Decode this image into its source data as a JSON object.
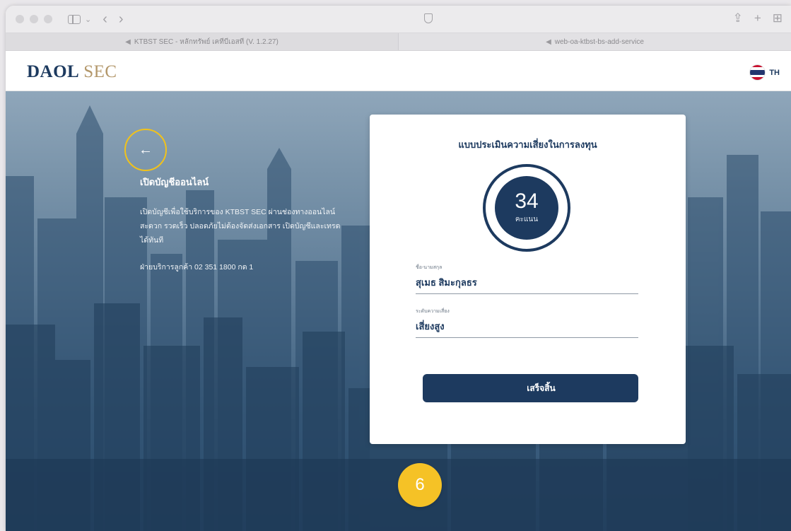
{
  "browser": {
    "tabs": [
      {
        "label": "KTBST SEC - หลักทรัพย์ เคทีบีเอสที (V. 1.2.27)",
        "active": true
      },
      {
        "label": "web-oa-ktbst-bs-add-service",
        "active": false
      }
    ]
  },
  "header": {
    "logo_primary": "DAOL",
    "logo_secondary": "SEC",
    "language": "TH"
  },
  "intro": {
    "back_icon": "arrow-left-icon",
    "title": "เปิดบัญชีออนไลน์",
    "description": "เปิดบัญชีเพื่อใช้บริการของ KTBST SEC ผ่านช่องทางออนไลน์ สะดวก รวดเร็ว ปลอดภัยไม่ต้องจัดส่งเอกสาร เปิดบัญชีและเทรดได้ทันที",
    "hotline": "ฝ่ายบริการลูกค้า 02 351 1800 กด 1"
  },
  "card": {
    "title": "แบบประเมินความเสี่ยงในการลงทุน",
    "score": "34",
    "score_unit": "คะแนน",
    "fields": [
      {
        "label": "ชื่อ-นามสกุล",
        "value": "สุเมธ สิมะกุลธร"
      },
      {
        "label": "ระดับความเสี่ยง",
        "value": "เสี่ยงสูง"
      }
    ],
    "submit_label": "เสร็จสิ้น"
  },
  "step_badge": "6",
  "colors": {
    "brand_navy": "#1d3a5f",
    "brand_gold": "#b3976a",
    "highlight_yellow": "#f5c226"
  }
}
